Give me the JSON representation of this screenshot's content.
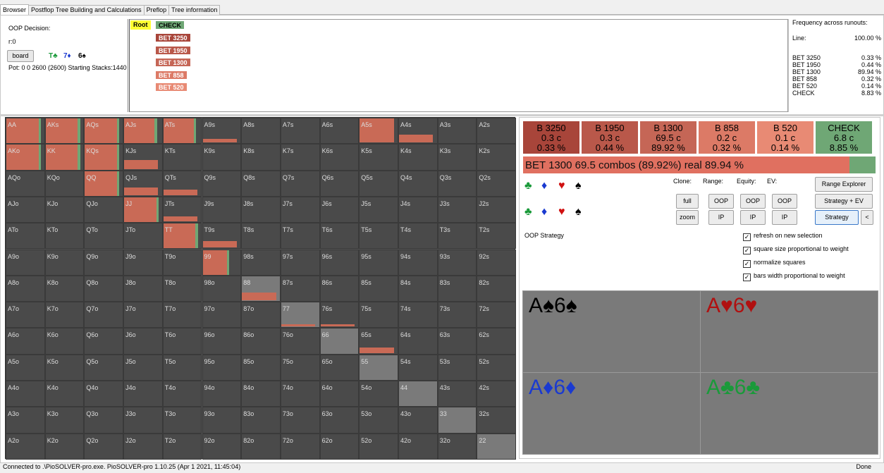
{
  "tabs": [
    "Browser",
    "Postflop Tree Building and Calculations",
    "Preflop",
    "Tree information"
  ],
  "info": {
    "decision": "OOP Decision:",
    "r": "r:0",
    "board_button": "board",
    "board_cards": [
      {
        "text": "T♣",
        "color": "#1a9a3a"
      },
      {
        "text": "7♦",
        "color": "#1a3ad0"
      },
      {
        "text": "6♠",
        "color": "#000000"
      }
    ],
    "pot": "Pot: 0 0 2600 (2600) Starting Stacks:1440"
  },
  "tree": {
    "root": "Root",
    "check": "CHECK",
    "bets": [
      "BET 3250",
      "BET 1950",
      "BET 1300",
      "BET 858",
      "BET 520"
    ],
    "bet_colors": [
      "#a8453a",
      "#b9584a",
      "#c56656",
      "#dc7a66",
      "#e88a74"
    ]
  },
  "frequency": {
    "title": "Frequency across runouts:",
    "line_label": "Line:",
    "line_value": "100.00 %",
    "rows": [
      {
        "label": "BET 3250",
        "value": "0.33 %"
      },
      {
        "label": "BET 1950",
        "value": "0.44 %"
      },
      {
        "label": "BET 1300",
        "value": "89.94 %"
      },
      {
        "label": "BET 858",
        "value": "0.32 %"
      },
      {
        "label": "BET 520",
        "value": "0.14 %"
      },
      {
        "label": "CHECK",
        "value": "8.83 %"
      }
    ]
  },
  "grid": {
    "rows": [
      [
        "AA",
        "AKs",
        "AQs",
        "AJs",
        "ATs",
        "A9s",
        "A8s",
        "A7s",
        "A6s",
        "A5s",
        "A4s",
        "A3s",
        "A2s"
      ],
      [
        "AKo",
        "KK",
        "KQs",
        "KJs",
        "KTs",
        "K9s",
        "K8s",
        "K7s",
        "K6s",
        "K5s",
        "K4s",
        "K3s",
        "K2s"
      ],
      [
        "AQo",
        "KQo",
        "QQ",
        "QJs",
        "QTs",
        "Q9s",
        "Q8s",
        "Q7s",
        "Q6s",
        "Q5s",
        "Q4s",
        "Q3s",
        "Q2s"
      ],
      [
        "AJo",
        "KJo",
        "QJo",
        "JJ",
        "JTs",
        "J9s",
        "J8s",
        "J7s",
        "J6s",
        "J5s",
        "J4s",
        "J3s",
        "J2s"
      ],
      [
        "ATo",
        "KTo",
        "QTo",
        "JTo",
        "TT",
        "T9s",
        "T8s",
        "T7s",
        "T6s",
        "T5s",
        "T4s",
        "T3s",
        "T2s"
      ],
      [
        "A9o",
        "K9o",
        "Q9o",
        "J9o",
        "T9o",
        "99",
        "98s",
        "97s",
        "96s",
        "95s",
        "94s",
        "93s",
        "92s"
      ],
      [
        "A8o",
        "K8o",
        "Q8o",
        "J8o",
        "T8o",
        "98o",
        "88",
        "87s",
        "86s",
        "85s",
        "84s",
        "83s",
        "82s"
      ],
      [
        "A7o",
        "K7o",
        "Q7o",
        "J7o",
        "T7o",
        "97o",
        "87o",
        "77",
        "76s",
        "75s",
        "74s",
        "73s",
        "72s"
      ],
      [
        "A6o",
        "K6o",
        "Q6o",
        "J6o",
        "T6o",
        "96o",
        "86o",
        "76o",
        "66",
        "65s",
        "64s",
        "63s",
        "62s"
      ],
      [
        "A5o",
        "K5o",
        "Q5o",
        "J5o",
        "T5o",
        "95o",
        "85o",
        "75o",
        "65o",
        "55",
        "54s",
        "53s",
        "52s"
      ],
      [
        "A4o",
        "K4o",
        "Q4o",
        "J4o",
        "T4o",
        "94o",
        "84o",
        "74o",
        "64o",
        "54o",
        "44",
        "43s",
        "42s"
      ],
      [
        "A3o",
        "K3o",
        "Q3o",
        "J3o",
        "T3o",
        "93o",
        "83o",
        "73o",
        "63o",
        "53o",
        "43o",
        "33",
        "32s"
      ],
      [
        "A2o",
        "K2o",
        "Q2o",
        "J2o",
        "T2o",
        "92o",
        "82o",
        "72o",
        "62o",
        "52o",
        "42o",
        "32o",
        "22"
      ]
    ]
  },
  "actions": [
    {
      "name": "B 3250",
      "combos": "0.3 c",
      "pct": "0.33 %",
      "color": "#a8453a"
    },
    {
      "name": "B 1950",
      "combos": "0.3 c",
      "pct": "0.44 %",
      "color": "#b9584a"
    },
    {
      "name": "B 1300",
      "combos": "69.5 c",
      "pct": "89.92 %",
      "color": "#c56656"
    },
    {
      "name": "B 858",
      "combos": "0.2 c",
      "pct": "0.32 %",
      "color": "#dc7a66"
    },
    {
      "name": "B 520",
      "combos": "0.1 c",
      "pct": "0.14 %",
      "color": "#e88a74"
    },
    {
      "name": "CHECK",
      "combos": "6.8 c",
      "pct": "8.85 %",
      "color": "#6fa775"
    }
  ],
  "summary_bar": "BET 1300   69.5 combos (89.92%) real  89.94 %",
  "controls": {
    "clone_label": "Clone:",
    "range_label": "Range:",
    "equity_label": "Equity:",
    "ev_label": "EV:",
    "full": "full",
    "zoom": "zoom",
    "oop": "OOP",
    "ip": "IP",
    "range_explorer": "Range Explorer",
    "strategy_ev": "Strategy + EV",
    "strategy": "Strategy",
    "collapse": "<",
    "oop_strategy": "OOP Strategy"
  },
  "checkboxes": [
    "refresh on new selection",
    "square size proportional to weight",
    "normalize squares",
    "bars width proportional to weight"
  ],
  "combos": [
    {
      "text": "A♠6♠",
      "color": "#000000"
    },
    {
      "text": "A♥6♥",
      "color": "#b01010"
    },
    {
      "text": "A♦6♦",
      "color": "#1a3ad0"
    },
    {
      "text": "A♣6♣",
      "color": "#1a9a3a"
    }
  ],
  "status": "Connected to .\\PioSOLVER-pro.exe. PioSOLVER-pro 1.10.25 (Apr  1 2021, 11:45:04)",
  "done": "Done"
}
